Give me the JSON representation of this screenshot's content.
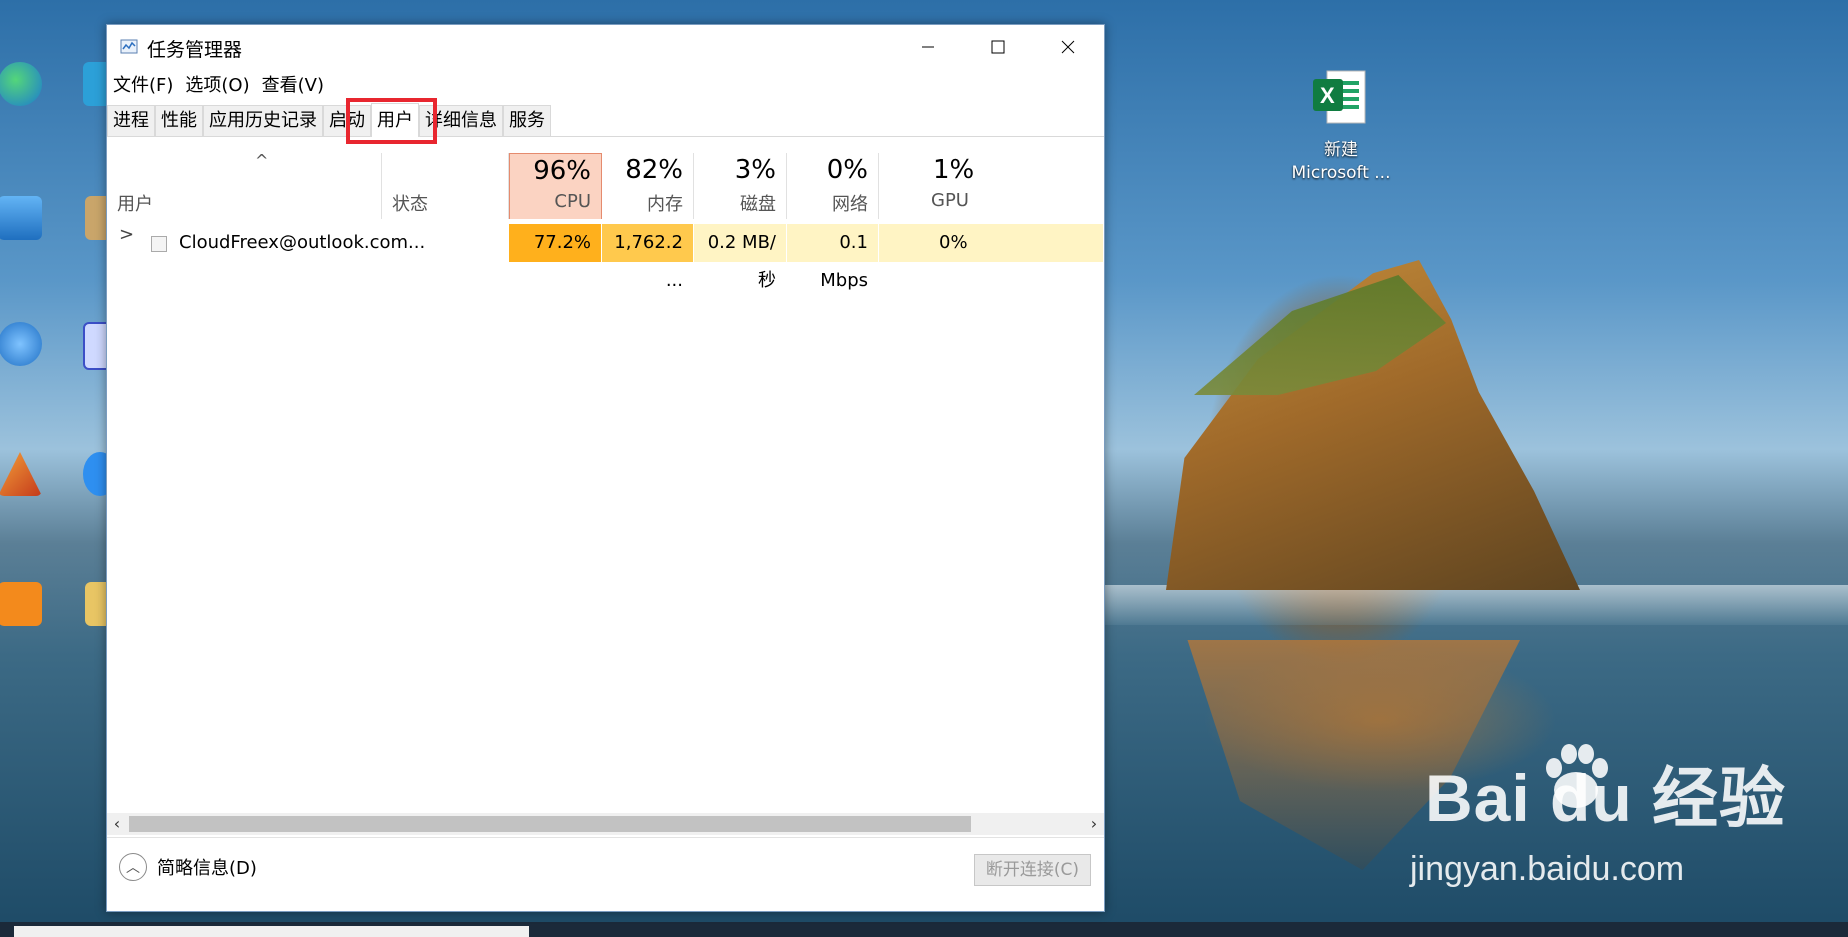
{
  "window": {
    "title": "任务管理器",
    "minimize_icon": "minimize-icon",
    "maximize_icon": "maximize-icon",
    "close_icon": "close-icon"
  },
  "menu": [
    "文件(F)",
    "选项(O)",
    "查看(V)"
  ],
  "tabs": [
    {
      "label": "进程",
      "active": false
    },
    {
      "label": "性能",
      "active": false
    },
    {
      "label": "应用历史记录",
      "active": false
    },
    {
      "label": "启动",
      "active": false
    },
    {
      "label": "用户",
      "active": true
    },
    {
      "label": "详细信息",
      "active": false
    },
    {
      "label": "服务",
      "active": false
    }
  ],
  "columns": {
    "user": "用户",
    "status": "状态",
    "cpu": {
      "percent": "96%",
      "label": "CPU"
    },
    "memory": {
      "percent": "82%",
      "label": "内存"
    },
    "disk": {
      "percent": "3%",
      "label": "磁盘"
    },
    "network": {
      "percent": "0%",
      "label": "网络"
    },
    "gpu": {
      "percent": "1%",
      "label": "GPU"
    }
  },
  "rows": [
    {
      "user": "CloudFreex@outlook.com...",
      "status": "",
      "cpu": "77.2%",
      "memory": "1,762.2 ...",
      "disk": "0.2 MB/秒",
      "network": "0.1 Mbps",
      "gpu": "0%"
    }
  ],
  "footer": {
    "brief_label": "简略信息(D)",
    "disconnect_label": "断开连接(C)"
  },
  "desktop": {
    "excel_icon_label": "新建\nMicrosoft ...",
    "watermark_text": "Bai  du 经验",
    "watermark_url": "jingyan.baidu.com"
  },
  "colors": {
    "cpu_header": "#fbd3c2",
    "cpu_cell": "#ffb01c",
    "memory_cell": "#ffc94d",
    "light_cell": "#fff4c4",
    "highlight": "#e8262f"
  }
}
